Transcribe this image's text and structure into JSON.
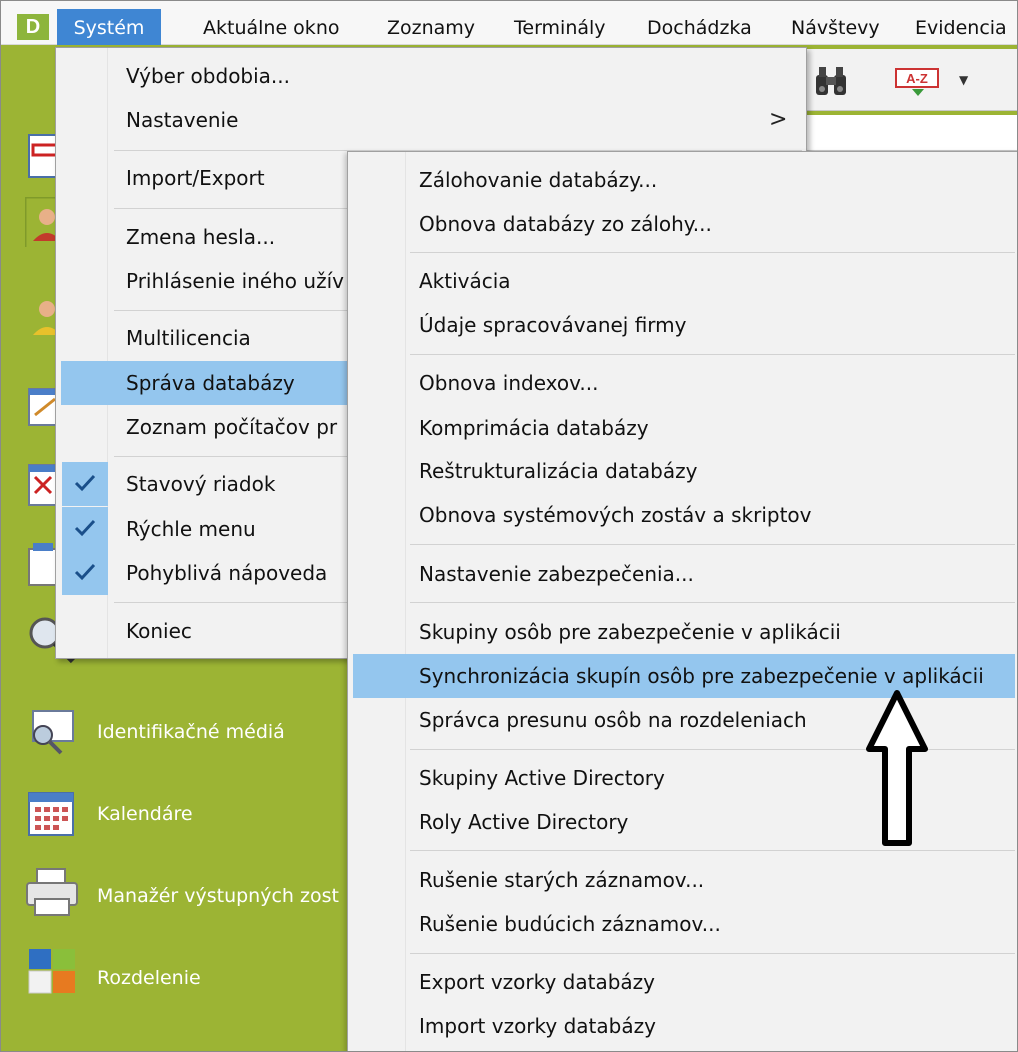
{
  "menubar": {
    "logo": "D",
    "items": [
      "Systém",
      "Aktuálne okno",
      "Zoznamy",
      "Terminály",
      "Dochádzka",
      "Návštevy",
      "Evidencia"
    ]
  },
  "toolbar": {
    "sort_label": "A-Z"
  },
  "sidebar": {
    "items": [
      {
        "label": "Identifikačné médiá",
        "icon": "id-media-key-icon"
      },
      {
        "label": "Kalendáre",
        "icon": "calendar-icon"
      },
      {
        "label": "Manažér výstupných zost",
        "icon": "printer-icon"
      },
      {
        "label": "Rozdelenie",
        "icon": "division-tiles-icon"
      }
    ]
  },
  "system_menu": {
    "items": [
      {
        "label": "Výber obdobia..."
      },
      {
        "label": "Nastavenie",
        "submenu": true,
        "arrow": ">"
      },
      {
        "label": "Import/Export"
      },
      {
        "label": "Zmena hesla..."
      },
      {
        "label": "Prihlásenie iného užív"
      },
      {
        "label": "Multilicencia"
      },
      {
        "label": "Správa databázy",
        "highlighted": true
      },
      {
        "label": "Zoznam počítačov pr"
      },
      {
        "label": "Stavový riadok",
        "checked": true
      },
      {
        "label": "Rýchle menu",
        "checked": true
      },
      {
        "label": "Pohyblivá nápoveda",
        "checked": true
      },
      {
        "label": "Koniec"
      }
    ]
  },
  "database_menu": {
    "items": [
      {
        "label": "Zálohovanie databázy..."
      },
      {
        "label": "Obnova databázy zo zálohy..."
      },
      {
        "label": "Aktivácia"
      },
      {
        "label": "Údaje spracovávanej firmy"
      },
      {
        "label": "Obnova indexov..."
      },
      {
        "label": "Komprimácia databázy"
      },
      {
        "label": "Reštrukturalizácia databázy"
      },
      {
        "label": "Obnova systémových zostáv a skriptov"
      },
      {
        "label": "Nastavenie zabezpečenia..."
      },
      {
        "label": "Skupiny osôb pre zabezpečenie v aplikácii"
      },
      {
        "label": "Synchronizácia skupín osôb pre zabezpečenie v aplikácii",
        "highlighted": true
      },
      {
        "label": "Správca presunu osôb na rozdeleniach"
      },
      {
        "label": "Skupiny Active Directory"
      },
      {
        "label": "Roly Active Directory"
      },
      {
        "label": "Rušenie starých záznamov..."
      },
      {
        "label": "Rušenie budúcich záznamov..."
      },
      {
        "label": "Export vzorky databázy"
      },
      {
        "label": "Import vzorky databázy"
      }
    ]
  },
  "colors": {
    "sidebar_green": "#9cb434",
    "highlight": "#94c6ee",
    "menu_bg": "#f2f2f2",
    "selected_menubar": "#3f86d3"
  }
}
